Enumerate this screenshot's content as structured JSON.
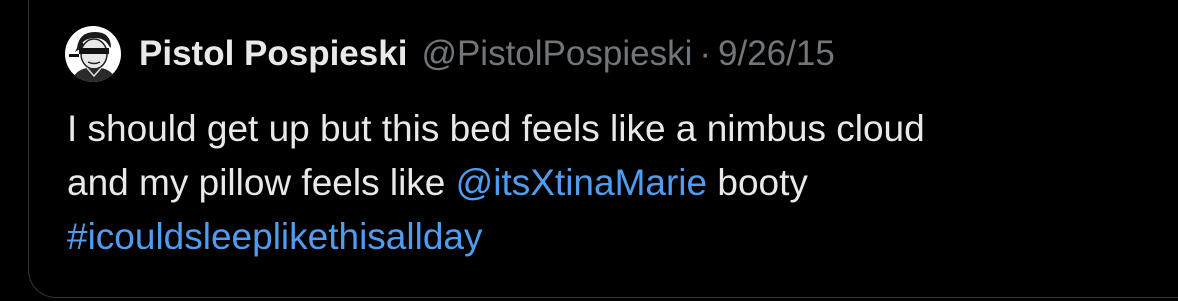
{
  "tweet": {
    "author_name": "Pistol Pospieski",
    "author_handle": "@PistolPospieski",
    "separator": "·",
    "date": "9/26/15",
    "avatar_icon": "avatar-drawing-icon",
    "text": {
      "line1": "I should get up but this bed feels like a nimbus cloud",
      "line2_prefix": "and my pillow feels like ",
      "mention": "@itsXtinaMarie",
      "line2_suffix": " booty",
      "hashtag": "#icouldsleeplikethisallday"
    }
  },
  "colors": {
    "background": "#000000",
    "border": "#333639",
    "text_primary": "#e7e9ea",
    "text_secondary": "#71767b",
    "link": "#4f9cf0"
  }
}
